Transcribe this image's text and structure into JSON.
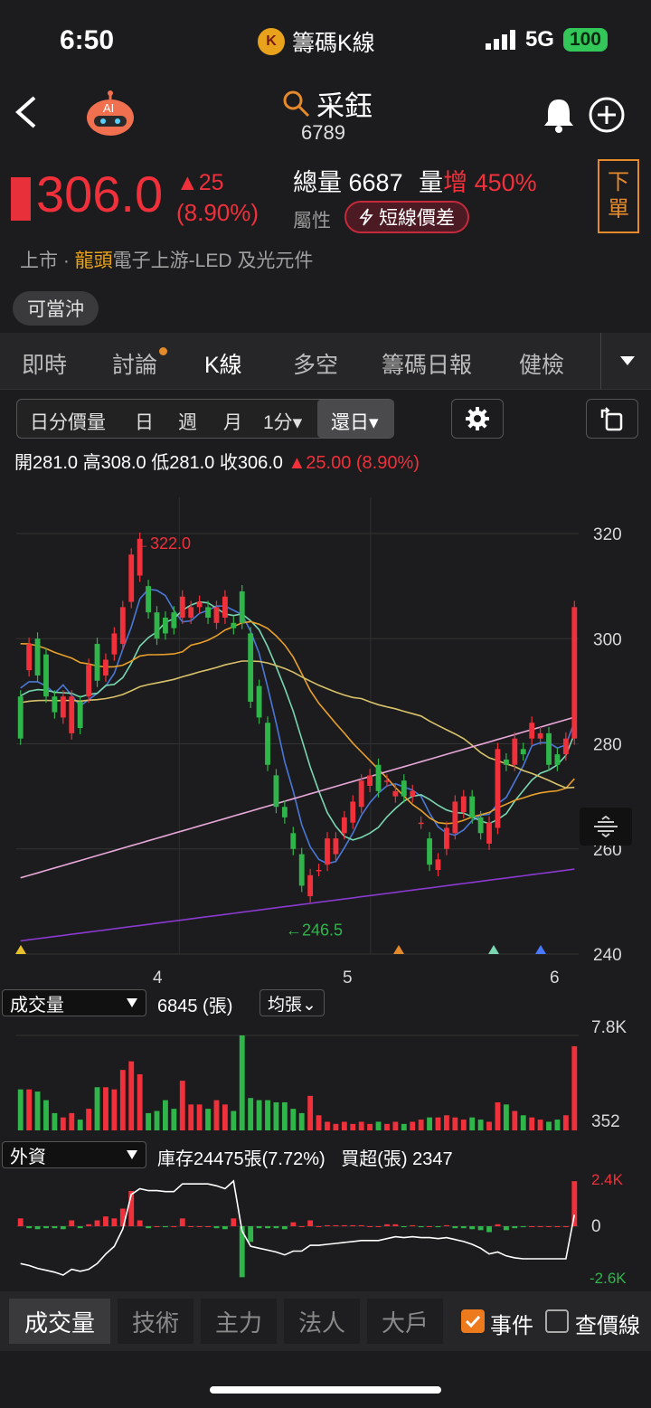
{
  "status": {
    "time": "6:50",
    "app_name": "籌碼K線",
    "network": "5G",
    "battery": "100"
  },
  "header": {
    "name": "采鈺",
    "code": "6789"
  },
  "quote": {
    "price": "306.0",
    "change": "▲25",
    "change_pct": "(8.90%)",
    "volume_label": "總量",
    "volume": "6687",
    "vol_ratio_label": "量",
    "vol_ratio_word": "增",
    "vol_ratio": "450%",
    "attr_label": "屬性",
    "attr_tag": "短線價差",
    "order_btn_1": "下",
    "order_btn_2": "單",
    "market": "上市",
    "market_dot": " · ",
    "leader": "龍頭",
    "industry": "電子上游-LED 及光元件",
    "day_trade": "可當沖"
  },
  "tabs": [
    "即時",
    "討論",
    "K線",
    "多空",
    "籌碼日報",
    "健檢"
  ],
  "periods": [
    "日分價量",
    "日",
    "週",
    "月",
    "1分▾",
    "還日▾"
  ],
  "ohlc": {
    "open_label": "開",
    "open": "281.0",
    "high_label": "高",
    "high": "308.0",
    "low_label": "低",
    "low": "281.0",
    "close_label": "收",
    "close": "306.0",
    "change": "▲25.00 (8.90%)"
  },
  "chart_data": {
    "type": "candlestick",
    "y_ticks": [
      "320",
      "300",
      "280",
      "260",
      "240"
    ],
    "x_ticks": [
      "4",
      "5",
      "6"
    ],
    "annotations": [
      "←322.0",
      "←246.5"
    ],
    "ylim": [
      240,
      320
    ],
    "candles": [
      {
        "o": 289,
        "c": 281
      },
      {
        "o": 294,
        "c": 299
      },
      {
        "o": 300,
        "c": 293
      },
      {
        "o": 297,
        "c": 289
      },
      {
        "o": 289,
        "c": 286
      },
      {
        "o": 285,
        "c": 289
      },
      {
        "o": 282,
        "c": 289
      },
      {
        "o": 288,
        "c": 283
      },
      {
        "o": 289,
        "c": 295
      },
      {
        "o": 299,
        "c": 292
      },
      {
        "o": 293,
        "c": 296
      },
      {
        "o": 297,
        "c": 301
      },
      {
        "o": 299,
        "c": 306
      },
      {
        "o": 307,
        "c": 316
      },
      {
        "o": 312,
        "c": 319
      },
      {
        "o": 310,
        "c": 305
      },
      {
        "o": 305,
        "c": 300
      },
      {
        "o": 304,
        "c": 301
      },
      {
        "o": 305,
        "c": 302
      },
      {
        "o": 304,
        "c": 308
      },
      {
        "o": 304,
        "c": 306
      },
      {
        "o": 306,
        "c": 307
      },
      {
        "o": 306,
        "c": 304
      },
      {
        "o": 303,
        "c": 306
      },
      {
        "o": 304,
        "c": 308
      },
      {
        "o": 303,
        "c": 302
      },
      {
        "o": 309,
        "c": 303
      },
      {
        "o": 301,
        "c": 288
      },
      {
        "o": 291,
        "c": 285
      },
      {
        "o": 284,
        "c": 276
      },
      {
        "o": 274,
        "c": 268
      },
      {
        "o": 268,
        "c": 266
      },
      {
        "o": 263,
        "c": 260
      },
      {
        "o": 259,
        "c": 253
      },
      {
        "o": 251,
        "c": 255
      },
      {
        "o": 256,
        "c": 256
      },
      {
        "o": 257,
        "c": 262
      },
      {
        "o": 259,
        "c": 262
      },
      {
        "o": 263,
        "c": 266
      },
      {
        "o": 265,
        "c": 269
      },
      {
        "o": 268,
        "c": 273
      },
      {
        "o": 272,
        "c": 274
      },
      {
        "o": 276,
        "c": 271
      },
      {
        "o": 273,
        "c": 273
      },
      {
        "o": 270,
        "c": 271
      },
      {
        "o": 273,
        "c": 270
      },
      {
        "o": 270,
        "c": 271
      },
      {
        "o": 265,
        "c": 265
      },
      {
        "o": 262,
        "c": 257
      },
      {
        "o": 256,
        "c": 258
      },
      {
        "o": 260,
        "c": 264
      },
      {
        "o": 263,
        "c": 269
      },
      {
        "o": 267,
        "c": 270
      },
      {
        "o": 270,
        "c": 266
      },
      {
        "o": 266,
        "c": 263
      },
      {
        "o": 261,
        "c": 265
      },
      {
        "o": 264,
        "c": 279
      },
      {
        "o": 277,
        "c": 276
      },
      {
        "o": 276,
        "c": 281
      },
      {
        "o": 279,
        "c": 278
      },
      {
        "o": 281,
        "c": 284
      },
      {
        "o": 281,
        "c": 282
      },
      {
        "o": 282,
        "c": 276
      },
      {
        "o": 278,
        "c": 276
      },
      {
        "o": 278,
        "c": 281
      },
      {
        "o": 281,
        "c": 306
      }
    ],
    "volume_ticks": [
      "7.8K",
      "352"
    ],
    "volume": [
      1.9,
      1.9,
      1.8,
      1.4,
      0.8,
      0.6,
      0.8,
      0.5,
      1.0,
      2.0,
      2.0,
      1.9,
      2.8,
      3.2,
      2.6,
      0.8,
      0.9,
      1.4,
      1.0,
      2.3,
      1.2,
      1.2,
      1.0,
      1.4,
      1.2,
      0.9,
      4.4,
      1.5,
      1.4,
      1.4,
      1.3,
      1.3,
      1.0,
      0.8,
      1.6,
      0.7,
      0.4,
      0.3,
      0.4,
      0.3,
      0.4,
      0.3,
      0.4,
      0.3,
      0.4,
      0.3,
      0.4,
      0.5,
      0.6,
      0.6,
      0.7,
      0.6,
      0.5,
      0.6,
      0.5,
      0.4,
      1.3,
      1.2,
      0.9,
      0.7,
      0.6,
      0.5,
      0.4,
      0.5,
      0.7,
      3.9
    ],
    "foreign_ticks": [
      "2.4K",
      "0",
      "-2.6K"
    ],
    "foreign_net": [
      400,
      -100,
      -150,
      -100,
      -100,
      -150,
      300,
      -100,
      100,
      300,
      500,
      400,
      900,
      1800,
      300,
      -100,
      0,
      -50,
      0,
      400,
      0,
      0,
      0,
      -100,
      -150,
      400,
      -2600,
      -800,
      -100,
      -100,
      -100,
      -150,
      200,
      0,
      300,
      0,
      50,
      50,
      50,
      50,
      50,
      0,
      0,
      100,
      100,
      -50,
      50,
      -50,
      0,
      -50,
      50,
      -100,
      -100,
      -150,
      -200,
      -300,
      100,
      -200,
      -100,
      -50,
      0,
      0,
      0,
      0,
      0,
      2300
    ]
  },
  "volume_panel": {
    "selector": "成交量",
    "value": "6845 (張)",
    "avg_btn": "均張⌄"
  },
  "foreign_panel": {
    "selector": "外資",
    "inventory": "庫存24475張(7.72%)",
    "net_label": "買超(張)",
    "net": "2347"
  },
  "bottom_tabs": [
    "成交量",
    "技術",
    "主力",
    "法人",
    "大戶"
  ],
  "checkboxes": [
    {
      "label": "事件",
      "checked": true
    },
    {
      "label": "查價線",
      "checked": false
    }
  ],
  "colors": {
    "up": "#f0303a",
    "down": "#2fb54a",
    "accent": "#e58a2b",
    "ma5": "#4a78d8",
    "ma10": "#7ad6b0",
    "ma20": "#e8a02a",
    "ma60": "#d8c26a",
    "ma120": "#e8a8d8",
    "ma240": "#8a3ad0"
  }
}
